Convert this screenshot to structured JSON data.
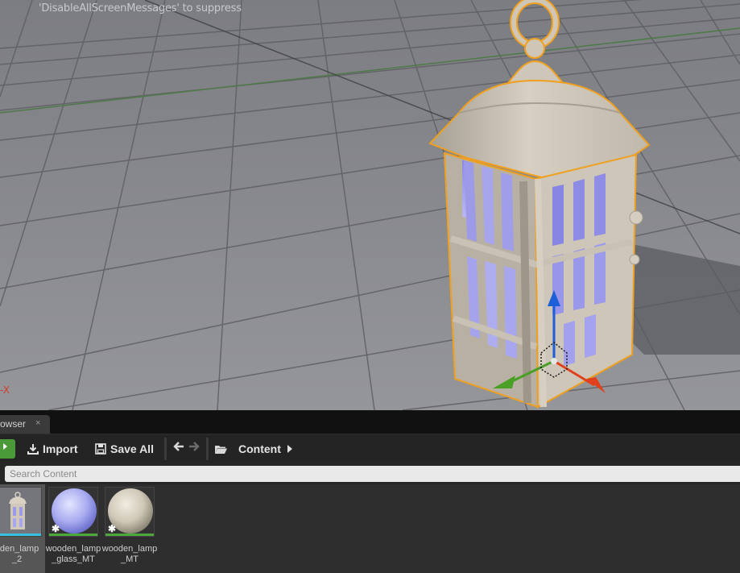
{
  "viewport": {
    "screen_message": "'DisableAllScreenMessages' to suppress",
    "axis_label": "-X"
  },
  "browser": {
    "tab_label": "owser",
    "tab_close": "×",
    "import_label": "Import",
    "save_all_label": "Save All",
    "path_label": "Content",
    "search_placeholder": "Search Content",
    "assets": [
      {
        "name_line1": "oden_lamp",
        "name_line2": "_2",
        "type": "static-mesh",
        "bar_color": "#35c2e0"
      },
      {
        "name_line1": "wooden_lamp",
        "name_line2": "_glass_MT",
        "type": "material",
        "bar_color": "#4da83c"
      },
      {
        "name_line1": "wooden_lamp",
        "name_line2": "_MT",
        "type": "material",
        "bar_color": "#4da83c"
      }
    ]
  },
  "colors": {
    "selection_outline": "#f0a020",
    "gizmo_x": "#e0401c",
    "gizmo_y": "#4aa026",
    "gizmo_z": "#1d5fd6"
  }
}
